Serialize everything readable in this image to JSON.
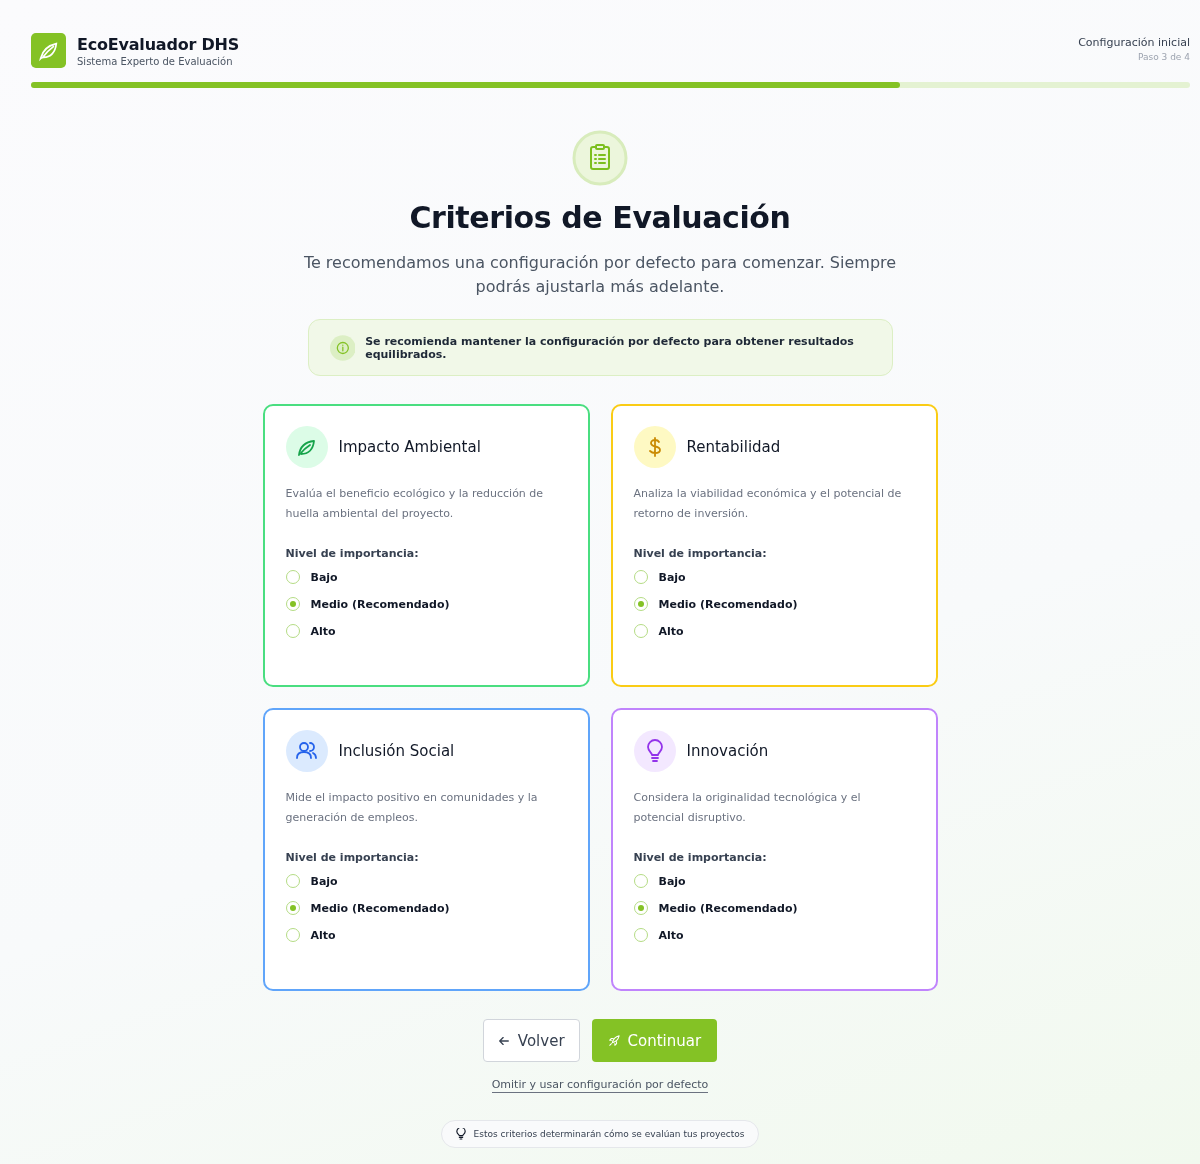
{
  "brand": {
    "name": "EcoEvaluador DHS",
    "tagline": "Sistema Experto de Evaluación"
  },
  "step": {
    "title": "Configuración inicial",
    "counter": "Paso 3 de 4",
    "level": 0.75
  },
  "heading": "Criterios de Evaluación",
  "intro": "Te recomendamos una configuración por defecto para comenzar. Siempre podrás ajustarla más adelante.",
  "notice": "Se recomienda mantener la configuración por defecto para obtener resultados equilibrados.",
  "criteria": [
    {
      "kind": "leaf",
      "color": "#4ade80",
      "title": "Impacto Ambiental",
      "description": "Evalúa el beneficio ecológico y la reducción de huella ambiental del proyecto.",
      "level_label": "Nivel de importancia:",
      "options": [
        {
          "label": "Bajo",
          "selected": false
        },
        {
          "label": "Medio (Recomendado)",
          "selected": true
        },
        {
          "label": "Alto",
          "selected": false
        }
      ]
    },
    {
      "kind": "dollar",
      "color": "#facc15",
      "title": "Rentabilidad",
      "description": "Analiza la viabilidad económica y el potencial de retorno de inversión.",
      "level_label": "Nivel de importancia:",
      "options": [
        {
          "label": "Bajo",
          "selected": false
        },
        {
          "label": "Medio (Recomendado)",
          "selected": true
        },
        {
          "label": "Alto",
          "selected": false
        }
      ]
    },
    {
      "kind": "people",
      "color": "#60a5fa",
      "title": "Inclusión Social",
      "description": "Mide el impacto positivo en comunidades y la generación de empleos.",
      "level_label": "Nivel de importancia:",
      "options": [
        {
          "label": "Bajo",
          "selected": false
        },
        {
          "label": "Medio (Recomendado)",
          "selected": true
        },
        {
          "label": "Alto",
          "selected": false
        }
      ]
    },
    {
      "kind": "bulb",
      "color": "#c084fc",
      "title": "Innovación",
      "description": "Considera la originalidad tecnológica y el potencial disruptivo.",
      "level_label": "Nivel de importancia:",
      "options": [
        {
          "label": "Bajo",
          "selected": false
        },
        {
          "label": "Medio (Recomendado)",
          "selected": true
        },
        {
          "label": "Alto",
          "selected": false
        }
      ]
    }
  ],
  "buttons": {
    "back": "Volver",
    "next": "Continuar"
  },
  "skip_link": "Omitir y usar configuración por defecto",
  "footer_tip": "Estos criterios determinarán cómo se evalúan tus proyectos"
}
